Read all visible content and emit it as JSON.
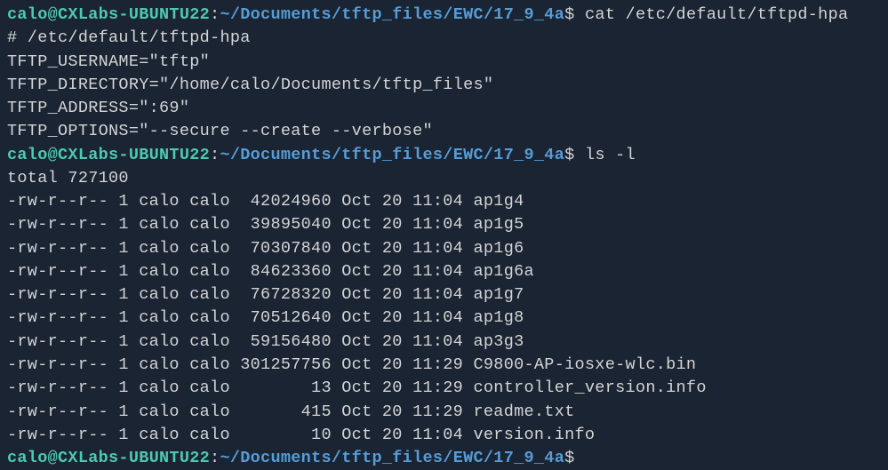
{
  "prompt": {
    "user_host": "calo@CXLabs-UBUNTU22",
    "colon": ":",
    "path": "~/Documents/tftp_files/EWC/17_9_4a",
    "dollar": "$"
  },
  "commands": {
    "cmd1": "cat /etc/default/tftpd-hpa",
    "cmd2": "ls -l",
    "cmd3": ""
  },
  "cat_output": {
    "line1": "# /etc/default/tftpd-hpa",
    "line2": "",
    "line3": "TFTP_USERNAME=\"tftp\"",
    "line4": "TFTP_DIRECTORY=\"/home/calo/Documents/tftp_files\"",
    "line5": "TFTP_ADDRESS=\":69\"",
    "line6": "TFTP_OPTIONS=\"--secure --create --verbose\""
  },
  "ls_output": {
    "total": "total 727100",
    "rows": [
      {
        "perm": "-rw-r--r--",
        "links": "1",
        "owner": "calo",
        "group": "calo",
        "size": "42024960",
        "month": "Oct",
        "day": "20",
        "time": "11:04",
        "name": "ap1g4"
      },
      {
        "perm": "-rw-r--r--",
        "links": "1",
        "owner": "calo",
        "group": "calo",
        "size": "39895040",
        "month": "Oct",
        "day": "20",
        "time": "11:04",
        "name": "ap1g5"
      },
      {
        "perm": "-rw-r--r--",
        "links": "1",
        "owner": "calo",
        "group": "calo",
        "size": "70307840",
        "month": "Oct",
        "day": "20",
        "time": "11:04",
        "name": "ap1g6"
      },
      {
        "perm": "-rw-r--r--",
        "links": "1",
        "owner": "calo",
        "group": "calo",
        "size": "84623360",
        "month": "Oct",
        "day": "20",
        "time": "11:04",
        "name": "ap1g6a"
      },
      {
        "perm": "-rw-r--r--",
        "links": "1",
        "owner": "calo",
        "group": "calo",
        "size": "76728320",
        "month": "Oct",
        "day": "20",
        "time": "11:04",
        "name": "ap1g7"
      },
      {
        "perm": "-rw-r--r--",
        "links": "1",
        "owner": "calo",
        "group": "calo",
        "size": "70512640",
        "month": "Oct",
        "day": "20",
        "time": "11:04",
        "name": "ap1g8"
      },
      {
        "perm": "-rw-r--r--",
        "links": "1",
        "owner": "calo",
        "group": "calo",
        "size": "59156480",
        "month": "Oct",
        "day": "20",
        "time": "11:04",
        "name": "ap3g3"
      },
      {
        "perm": "-rw-r--r--",
        "links": "1",
        "owner": "calo",
        "group": "calo",
        "size": "301257756",
        "month": "Oct",
        "day": "20",
        "time": "11:29",
        "name": "C9800-AP-iosxe-wlc.bin"
      },
      {
        "perm": "-rw-r--r--",
        "links": "1",
        "owner": "calo",
        "group": "calo",
        "size": "13",
        "month": "Oct",
        "day": "20",
        "time": "11:29",
        "name": "controller_version.info"
      },
      {
        "perm": "-rw-r--r--",
        "links": "1",
        "owner": "calo",
        "group": "calo",
        "size": "415",
        "month": "Oct",
        "day": "20",
        "time": "11:29",
        "name": "readme.txt"
      },
      {
        "perm": "-rw-r--r--",
        "links": "1",
        "owner": "calo",
        "group": "calo",
        "size": "10",
        "month": "Oct",
        "day": "20",
        "time": "11:04",
        "name": "version.info"
      }
    ]
  }
}
